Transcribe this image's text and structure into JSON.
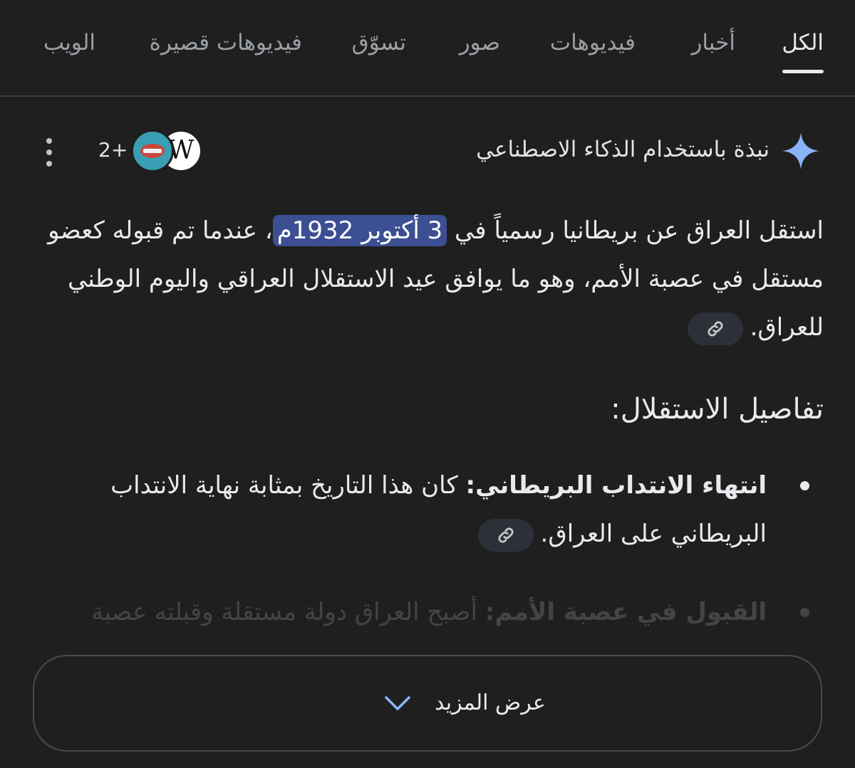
{
  "tabs": [
    {
      "label": "الكل",
      "active": true
    },
    {
      "label": "أخبار"
    },
    {
      "label": "فيديوهات"
    },
    {
      "label": "صور"
    },
    {
      "label": "تسوّق"
    },
    {
      "label": "فيديوهات قصيرة"
    },
    {
      "label": "الويب"
    }
  ],
  "ai_overview": {
    "title": "نبذة باستخدام الذكاء الاصطناعي",
    "sources_more": "2+",
    "wiki_letter": "W",
    "accent_color": "#8ab4f8"
  },
  "summary": {
    "before": "استقل العراق عن بريطانيا رسمياً في ",
    "highlight": "3 أكتوبر 1932م",
    "after": "، عندما تم قبوله كعضو مستقل في عصبة الأمم، وهو ما يوافق عيد الاستقلال العراقي واليوم الوطني للعراق."
  },
  "details": {
    "heading": "تفاصيل الاستقلال:",
    "items": [
      {
        "bold": "انتهاء الانتداب البريطاني:",
        "text": " كان هذا التاريخ بمثابة نهاية الانتداب البريطاني على العراق."
      },
      {
        "bold": "القبول في عصبة الأمم:",
        "text": " أصبح العراق دولة مستقلة وقبلته عصبة"
      }
    ]
  },
  "show_more": {
    "label": "عرض المزيد"
  }
}
